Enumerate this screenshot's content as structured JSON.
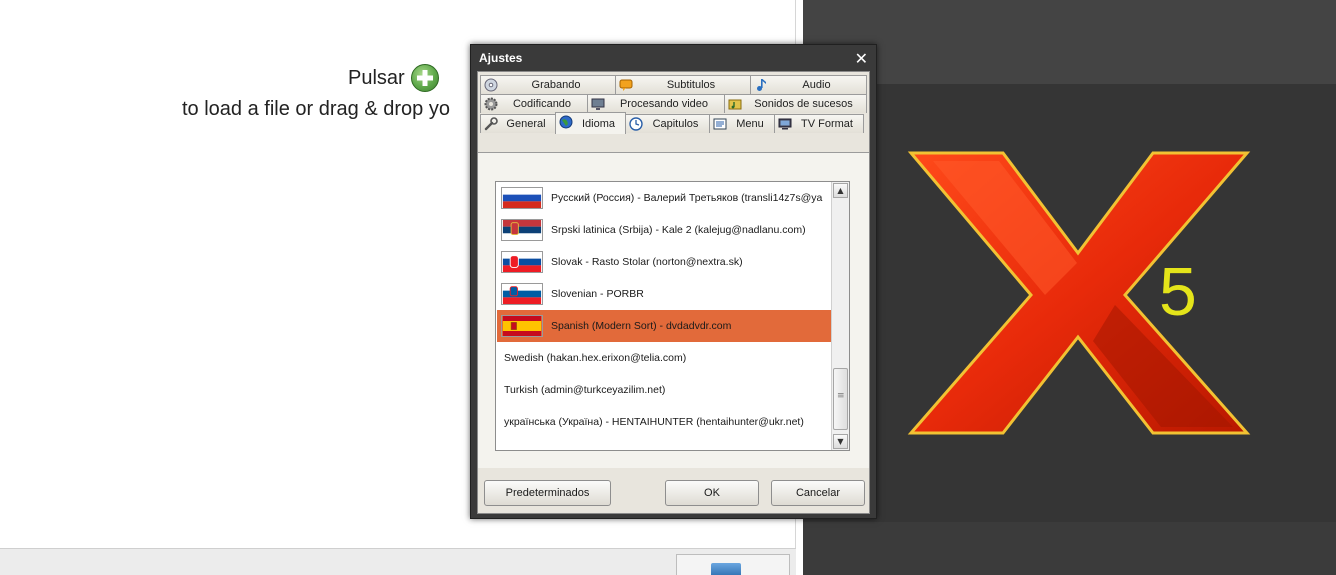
{
  "main": {
    "pulsar_label": "Pulsar",
    "load_hint": "to load a file or drag & drop yo"
  },
  "dialog": {
    "title": "Ajustes",
    "close_glyph": "✕",
    "tabs_row1": [
      {
        "label": "Grabando",
        "icon": "disc-icon"
      },
      {
        "label": "Subtitulos",
        "icon": "speech-bubble-icon"
      },
      {
        "label": "Audio",
        "icon": "music-note-icon"
      }
    ],
    "tabs_row2": [
      {
        "label": "Codificando",
        "icon": "gear-icon"
      },
      {
        "label": "Procesando video",
        "icon": "monitor-icon"
      },
      {
        "label": "Sonidos de sucesos",
        "icon": "sound-folder-icon"
      }
    ],
    "tabs_row3": [
      {
        "label": "General",
        "icon": "wrench-icon"
      },
      {
        "label": "Idioma",
        "icon": "globe-icon",
        "active": true
      },
      {
        "label": "Capitulos",
        "icon": "clock-icon"
      },
      {
        "label": "Menu",
        "icon": "menu-icon"
      },
      {
        "label": "TV Format",
        "icon": "tv-icon"
      }
    ],
    "languages": [
      {
        "text": "Русский (Россия) - Валерий Третьяков (transli14z7s@ya",
        "flag": "russia"
      },
      {
        "text": "Srpski latinica (Srbija) - Kale 2 (kalejug@nadlanu.com)",
        "flag": "serbia"
      },
      {
        "text": "Slovak - Rasto Stolar (norton@nextra.sk)",
        "flag": "slovakia"
      },
      {
        "text": "Slovenian - PORBR",
        "flag": "slovenia"
      },
      {
        "text": "Spanish (Modern Sort) - dvdadvdr.com",
        "flag": "spain",
        "selected": true
      },
      {
        "text": "Swedish (hakan.hex.erixon@telia.com)",
        "flag": ""
      },
      {
        "text": "Turkish (admin@turkceyazilim.net)",
        "flag": ""
      },
      {
        "text": "українська (Україна) - HENTAIHUNTER (hentaihunter@ukr.net)",
        "flag": ""
      }
    ],
    "buttons": {
      "defaults": "Predeterminados",
      "ok": "OK",
      "cancel": "Cancelar"
    },
    "selection_color": "#e26a3a"
  },
  "logo": {
    "version": "5",
    "accent": "#e4e41a",
    "x_color": "#e82a0a"
  }
}
